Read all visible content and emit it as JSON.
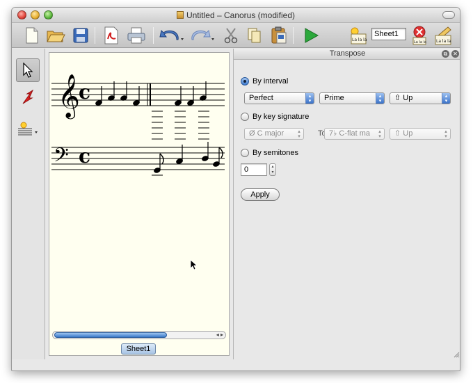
{
  "window": {
    "title": "Untitled – Canorus (modified)"
  },
  "toolbar": {
    "icons": [
      "new-file-icon",
      "open-folder-icon",
      "save-floppy-icon",
      "export-pdf-icon",
      "print-icon",
      "undo-icon",
      "redo-icon",
      "cut-icon",
      "copy-icon",
      "paste-icon",
      "play-icon",
      "lyrics-icon",
      "sheet-name-field",
      "remove-sheet-icon",
      "edit-lyrics-icon"
    ],
    "lyrics_label": "La la la",
    "sheet_name_value": "Sheet1"
  },
  "sidebar": {
    "tools": [
      "select-arrow-icon",
      "insert-note-icon",
      "new-context-icon"
    ]
  },
  "sheet_tab": {
    "label": "Sheet1"
  },
  "transpose_panel": {
    "title": "Transpose",
    "by_interval": {
      "label": "By interval",
      "selected": true,
      "quality": "Perfect",
      "interval": "Prime",
      "direction": "Up",
      "direction_icon": "up-arrow-icon"
    },
    "by_key_signature": {
      "label": "By key signature",
      "selected": false,
      "from_key_symbol": "Ø",
      "from_key": "C major",
      "to_label": "To",
      "to_key_symbol": "7♭",
      "to_key": "C-flat ma",
      "direction": "Up",
      "direction_icon": "up-arrow-icon"
    },
    "by_semitones": {
      "label": "By semitones",
      "selected": false,
      "value": "0"
    },
    "apply_label": "Apply"
  },
  "score": {
    "treble_clef": "𝄞",
    "bass_clef": "𝄢",
    "time_signature": "c"
  },
  "colors": {
    "sheet_background": "#fffff0",
    "accent_blue": "#3a78c8"
  }
}
